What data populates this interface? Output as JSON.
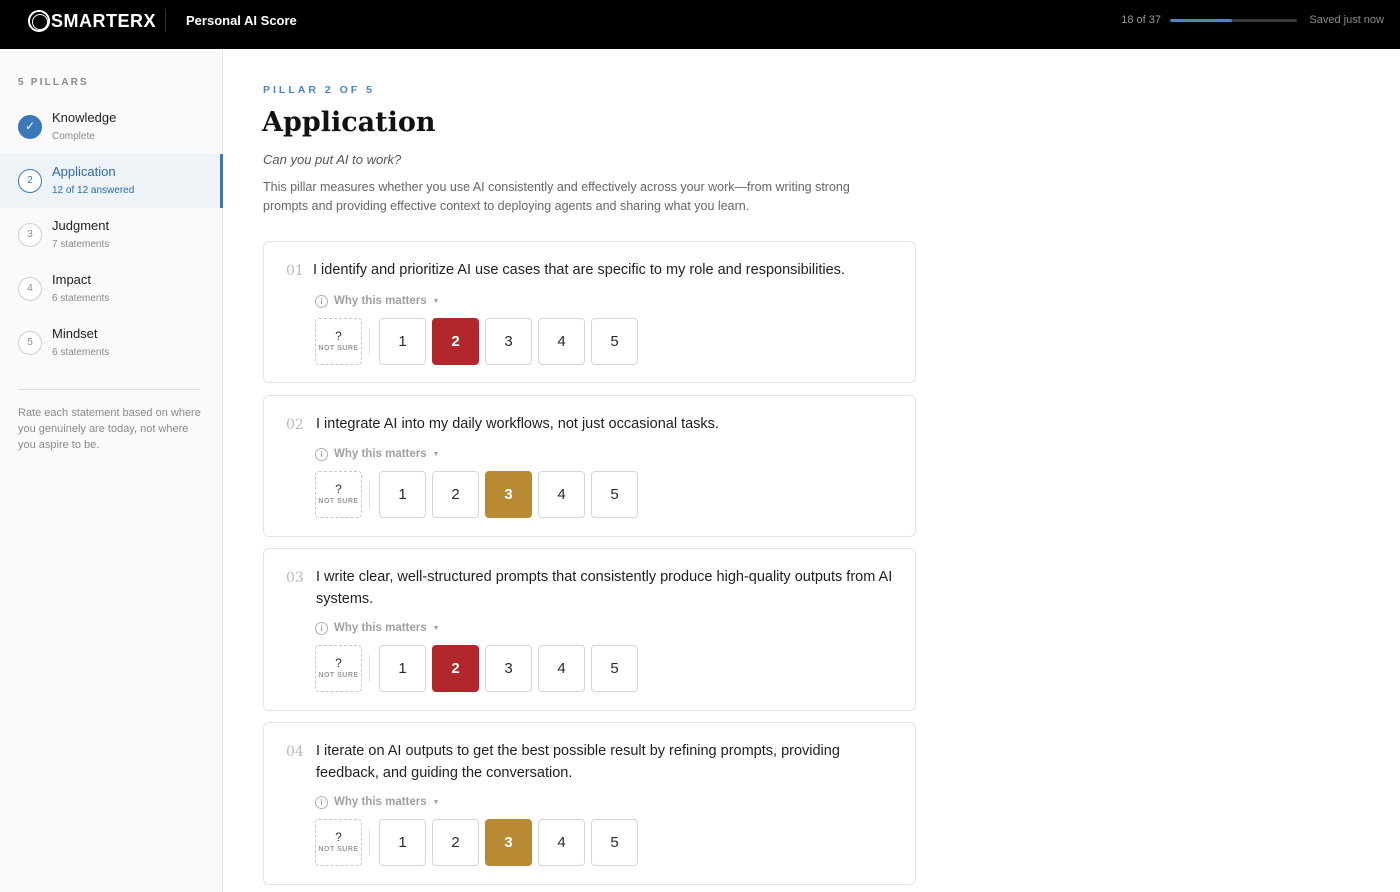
{
  "header": {
    "brand": "SMARTERX",
    "app_title": "Personal AI Score",
    "progress_label": "18 of 37",
    "progress_fraction": 0.486,
    "saved_status": "Saved just now"
  },
  "sidebar": {
    "heading": "5 PILLARS",
    "pillars": [
      {
        "marker": "✓",
        "name": "Knowledge",
        "sub": "Complete",
        "state": "done"
      },
      {
        "marker": "2",
        "name": "Application",
        "sub": "12 of 12 answered",
        "state": "active"
      },
      {
        "marker": "3",
        "name": "Judgment",
        "sub": "7 statements",
        "state": "pending"
      },
      {
        "marker": "4",
        "name": "Impact",
        "sub": "6 statements",
        "state": "pending"
      },
      {
        "marker": "5",
        "name": "Mindset",
        "sub": "6 statements",
        "state": "pending"
      }
    ],
    "note": "Rate each statement based on where you genuinely are today, not where you aspire to be."
  },
  "main": {
    "kicker": "PILLAR 2 OF 5",
    "title": "Application",
    "question": "Can you put AI to work?",
    "description": "This pillar measures whether you use AI consistently and effectively across your work—from writing strong prompts and providing effective context to deploying agents and sharing what you learn."
  },
  "scale": {
    "not_sure_symbol": "?",
    "not_sure_label": "NOT SURE",
    "options": [
      "1",
      "2",
      "3",
      "4",
      "5"
    ],
    "why_label": "Why this matters"
  },
  "statements": [
    {
      "num": "01",
      "text": "I identify and prioritize AI use cases that are specific to my role and responsibilities.",
      "selected": "2"
    },
    {
      "num": "02",
      "text": "I integrate AI into my daily workflows, not just occasional tasks.",
      "selected": "3"
    },
    {
      "num": "03",
      "text": "I write clear, well-structured prompts that consistently produce high-quality outputs from AI systems.",
      "selected": "2"
    },
    {
      "num": "04",
      "text": "I iterate on AI outputs to get the best possible result by refining prompts, providing feedback, and guiding the conversation.",
      "selected": "3"
    }
  ],
  "colors": {
    "accent": "#3b78ba",
    "selected_low": "#b1272b",
    "selected_mid": "#b88a33"
  }
}
